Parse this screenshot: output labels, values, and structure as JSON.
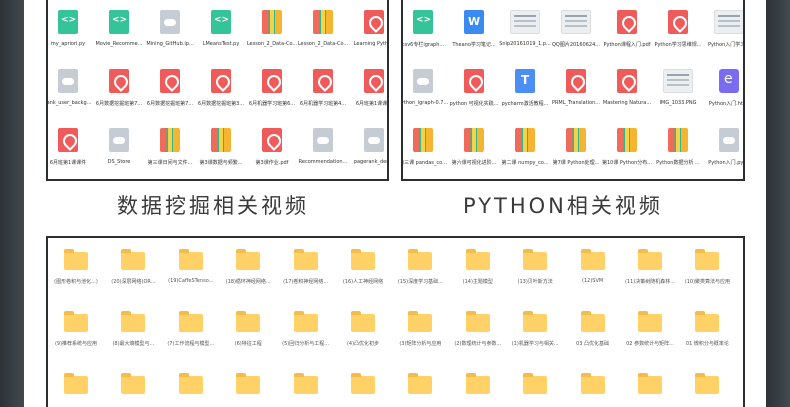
{
  "captions": {
    "left": "数据挖掘相关视频",
    "right": "PYTHON相关视频"
  },
  "top_left": {
    "rows": [
      [
        {
          "type": "code",
          "label": "my_apriori.py"
        },
        {
          "type": "code",
          "label": "Movie_Recomme..."
        },
        {
          "type": "cloud",
          "label": "Mining_GitHub.ip..."
        },
        {
          "type": "code",
          "label": "LMeansTest.py"
        },
        {
          "type": "zip",
          "label": "Lesson_2_Data-Co..."
        },
        {
          "type": "zip",
          "label": "Lesson_2_Data-Co..."
        },
        {
          "type": "pdf",
          "label": "Learning Python"
        }
      ],
      [
        {
          "type": "cloud",
          "label": "rank_user_backg..."
        },
        {
          "type": "pdf",
          "label": "6月数据挖掘班第7..."
        },
        {
          "type": "pdf",
          "label": "6月数据挖掘班第7..."
        },
        {
          "type": "pdf",
          "label": "6月数据挖掘班第3..."
        },
        {
          "type": "pdf",
          "label": "6月机器学习班第6..."
        },
        {
          "type": "pdf",
          "label": "6月机器学习班第4..."
        },
        {
          "type": "pdf",
          "label": "6月班第1课课件"
        }
      ],
      [
        {
          "type": "pdf",
          "label": "6月班第1课课件"
        },
        {
          "type": "cloud",
          "label": "DS_Store"
        },
        {
          "type": "zip",
          "label": "第三课日间与文件..."
        },
        {
          "type": "zip",
          "label": "第3课数据与频繁..."
        },
        {
          "type": "pdf",
          "label": "第3课作业.pdf"
        },
        {
          "type": "cloud",
          "label": "Recommendation..."
        },
        {
          "type": "cloud",
          "label": "pagerank_demo"
        }
      ]
    ]
  },
  "top_right": {
    "rows": [
      [
        {
          "type": "code",
          "label": "csv6专栏igraph..."
        },
        {
          "type": "word",
          "label": "Theano学习笔记..."
        },
        {
          "type": "thumb",
          "label": "Snip20161019_1.p..."
        },
        {
          "type": "thumb",
          "label": "QQ图片20160624..."
        },
        {
          "type": "pdf",
          "label": "Python课程入门.pdf"
        },
        {
          "type": "pdf",
          "label": "Python学习思维规..."
        },
        {
          "type": "thumb",
          "label": "Python入门学习..."
        }
      ],
      [
        {
          "type": "cloud",
          "label": "python_igraph-0.7..."
        },
        {
          "type": "pdf",
          "label": "python 可视化实践..."
        },
        {
          "type": "txt",
          "label": "pycharm激活教程..."
        },
        {
          "type": "pdf",
          "label": "PRML_Translation..."
        },
        {
          "type": "pdf",
          "label": "Mastering Natura..."
        },
        {
          "type": "thumb",
          "label": "IMG_1033.PNG"
        },
        {
          "type": "e",
          "label": "Python入门.html"
        }
      ],
      [
        {
          "type": "zip",
          "label": "第三课 pandas_co..."
        },
        {
          "type": "zip",
          "label": "第六课可视化进阶..."
        },
        {
          "type": "zip",
          "label": "第二课 numpy_co..."
        },
        {
          "type": "zip",
          "label": "第7课 Python处理..."
        },
        {
          "type": "zip",
          "label": "第10课 Python分布..."
        },
        {
          "type": "zip",
          "label": "Python数据分析 ..."
        },
        {
          "type": "cloud",
          "label": "Python入门.pynb"
        }
      ]
    ]
  },
  "bottom": {
    "rows": [
      [
        "(图形卷积与池化...)",
        "(20)深层网络(OR...",
        "(19)CaffeSTenso...",
        "(18)循环神经网络...",
        "(17)卷积神经网络...",
        "(16)人工神经网络",
        "(15)深度学习基础...",
        "(14)主题模型",
        "(13)贝叶斯方法",
        "(12)SVM",
        "(11)决策树随机森林...",
        "(10)聚类算法与应用"
      ],
      [
        "(9)推荐系统与应用",
        "(8)最大熵模型与...",
        "(7)工作流程与模型...",
        "(6)特征工程",
        "(5)回归分析与工程...",
        "(4)凸优化初步",
        "(3)矩阵分析与应用",
        "(2)数理统计与参数...",
        "(1)机器学习与相关...",
        "03 凸优化基础",
        "02 参数统计与矩阵...",
        "01 微积分与概率论"
      ],
      [
        "",
        "",
        "",
        "",
        "",
        "",
        "",
        "",
        "",
        "",
        "",
        ""
      ]
    ]
  }
}
